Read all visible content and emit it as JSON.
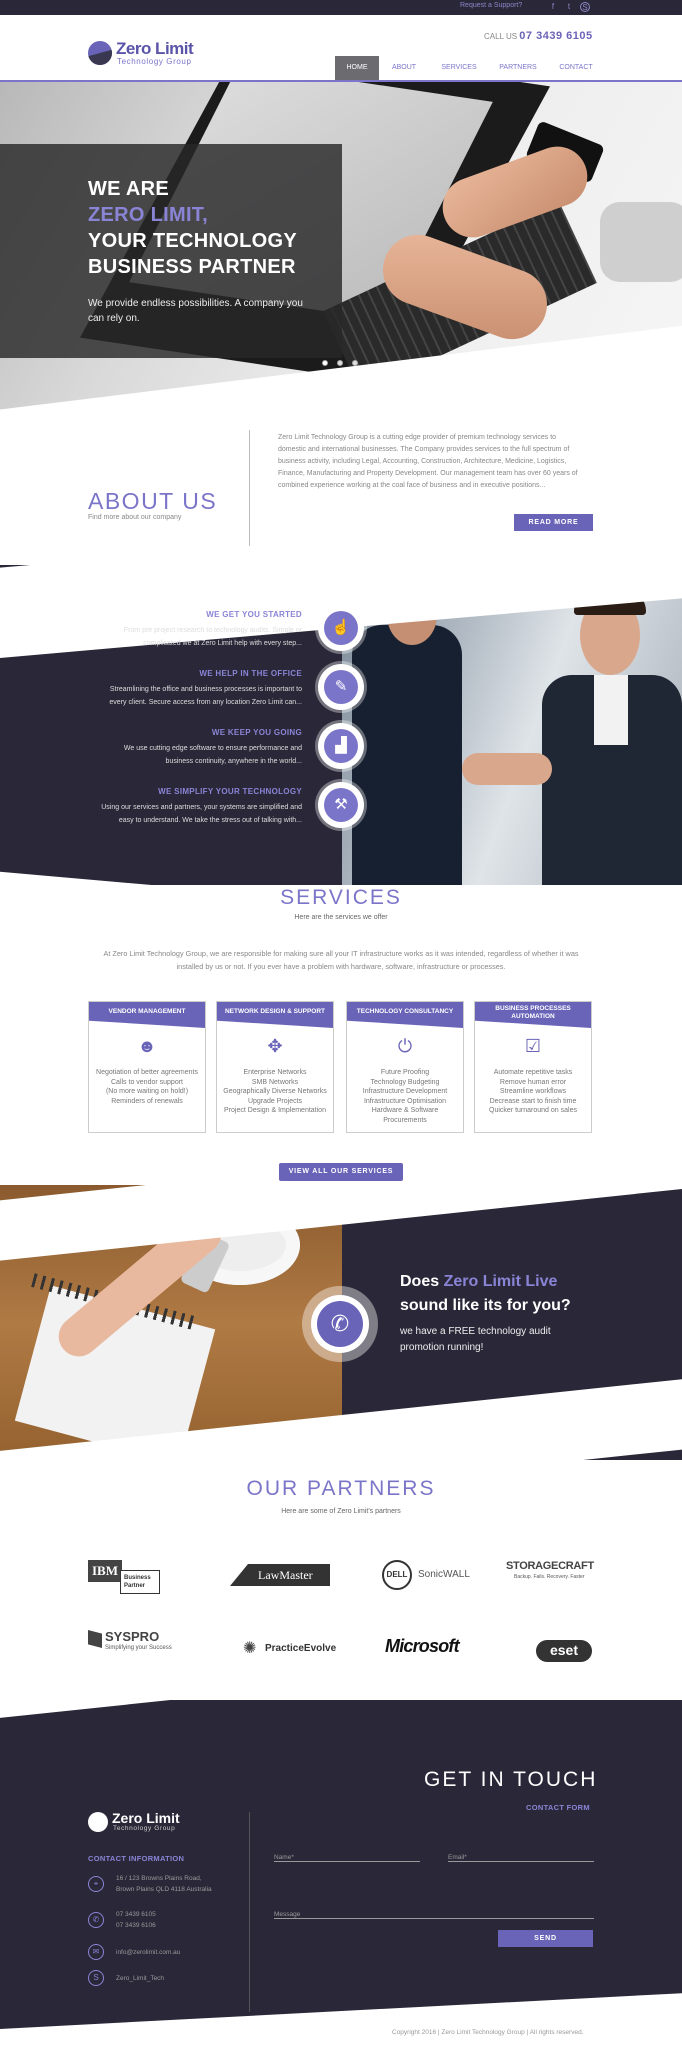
{
  "topbar": {
    "support_link": "Request a Support?",
    "social": [
      "facebook-icon",
      "twitter-icon",
      "skype-icon"
    ]
  },
  "header": {
    "logo_name": "Zero Limit",
    "logo_sub": "Technology Group",
    "call_label": "CALL US",
    "phone": "07 3439 6105",
    "nav": [
      "HOME",
      "ABOUT",
      "SERVICES",
      "PARTNERS",
      "CONTACT"
    ],
    "active_nav": "HOME"
  },
  "hero": {
    "line1": "WE ARE",
    "line2": "ZERO LIMIT,",
    "line3": "YOUR TECHNOLOGY",
    "line4": "BUSINESS PARTNER",
    "text1": "We provide endless possibilities. A company you",
    "text2": "can rely on.",
    "slides": 3,
    "active_slide": 1
  },
  "about": {
    "title": "ABOUT US",
    "subtitle": "Find more about our company",
    "lines": [
      "Zero Limit Technology Group is a cutting edge provider of premium technology services to",
      "domestic and international businesses. The Company provides services to the full spectrum of",
      "business activity, including Legal, Accounting, Construction, Architecture, Medicine, Logistics,",
      "Finance, Manufacturing and Property Development. Our management team has over 60 years of",
      "combined experience working at the coal face of business and in executive positions..."
    ],
    "button": "READ MORE"
  },
  "why": [
    {
      "title": "WE GET YOU STARTED",
      "l1": "From pre project research to technology audits. Simple or",
      "l2": "complicated we at Zero Limit help with every step...",
      "icon": "touch-icon"
    },
    {
      "title": "WE HELP IN THE OFFICE",
      "l1": "Streamlining the office and business processes is important to",
      "l2": "every client. Secure access from any location Zero Limit can...",
      "icon": "edit-icon"
    },
    {
      "title": "WE KEEP YOU GOING",
      "l1": "We use cutting edge software to ensure performance and",
      "l2": "business continuity, anywhere in the world...",
      "icon": "growth-chart-icon"
    },
    {
      "title": "WE SIMPLIFY YOUR TECHNOLOGY",
      "l1": "Using our services and partners, your systems are simplified and",
      "l2": "easy to understand. We take the stress out of talking with...",
      "icon": "tools-icon"
    }
  ],
  "services": {
    "title": "SERVICES",
    "subtitle": "Here are the services we offer",
    "intro1": "At Zero Limit Technology Group, we are responsible for making sure all your IT infrastructure works as it was intended, regardless of whether it was",
    "intro2": "installed by us or not. If you ever have a problem with hardware, software, infrastructure or processes.",
    "cards": [
      {
        "title": "VENDOR MANAGEMENT",
        "title2": "",
        "icon": "users-icon",
        "glyph": "☻",
        "items": [
          "Negotiation of better agreements",
          "Calls to vendor support",
          "(No more waiting on hold!)",
          "Reminders of renewals"
        ]
      },
      {
        "title": "NETWORK DESIGN & SUPPORT",
        "title2": "",
        "icon": "network-icon",
        "glyph": "✥",
        "items": [
          "Enterprise Networks",
          "SMB Networks",
          "Geographically Diverse Networks",
          "Upgrade Projects",
          "Project Design & Implementation"
        ]
      },
      {
        "title": "TECHNOLOGY CONSULTANCY",
        "title2": "",
        "icon": "power-icon",
        "glyph": "⏻",
        "items": [
          "Future Proofing",
          "Technology Budgeting",
          "Infrastructure Development",
          "Infrastructure Optimisation",
          "Hardware & Software",
          "Procurements"
        ]
      },
      {
        "title": "BUSINESS PROCESSES",
        "title2": "AUTOMATION",
        "icon": "checkbox-icon",
        "glyph": "☑",
        "items": [
          "Automate repetitive tasks",
          "Remove human error",
          "Streamline workflows",
          "Decrease start to finish time",
          "Quicker turnaround on sales"
        ]
      }
    ],
    "button": "VIEW ALL OUR SERVICES"
  },
  "live": {
    "t1a": "Does ",
    "t1b": "Zero Limit Live",
    "t2": "sound like its for you?",
    "p1": "we have a FREE technology audit",
    "p2": "promotion running!"
  },
  "partners": {
    "title": "OUR PARTNERS",
    "subtitle": "Here are some of Zero Limit's partners",
    "logos": [
      {
        "name": "ibm",
        "text": "IBM",
        "sub": "Business Partner"
      },
      {
        "name": "lawmaster",
        "text": "LawMaster",
        "sub": ""
      },
      {
        "name": "dell-sonicwall",
        "text": "DELL",
        "sub": "SonicWALL"
      },
      {
        "name": "storagecraft",
        "text": "STORAGECRAFT",
        "sub": "Backup. Fails. Recovery. Faster"
      },
      {
        "name": "syspro",
        "text": "SYSPRO",
        "sub": "Simplifying your Success"
      },
      {
        "name": "practiceevolve",
        "text": "PracticeEvolve",
        "sub": ""
      },
      {
        "name": "microsoft",
        "text": "Microsoft",
        "sub": ""
      },
      {
        "name": "eset",
        "text": "eset",
        "sub": ""
      }
    ]
  },
  "footer": {
    "title": "GET IN TOUCH",
    "form_label": "CONTACT FORM",
    "logo_name": "Zero Limit",
    "logo_sub": "Technology Group",
    "info_label": "CONTACT INFORMATION",
    "address1": "16 / 123 Browns Plains Road,",
    "address2": "Brown Plains QLD 4118 Australia",
    "phone1": "07 3439 6105",
    "phone2": "07 3439 6106",
    "email": "info@zerolimit.com.au",
    "skype": "Zero_Limit_Tech",
    "name_ph": "Name*",
    "email_ph": "Email*",
    "message_ph": "Message",
    "send": "SEND",
    "copyright": "Copyright 2016 | Zero Limit Technology Group | All rights reserved."
  },
  "colors": {
    "accent": "#7b75c9",
    "dark": "#2a2838",
    "button": "#6a64b8"
  }
}
